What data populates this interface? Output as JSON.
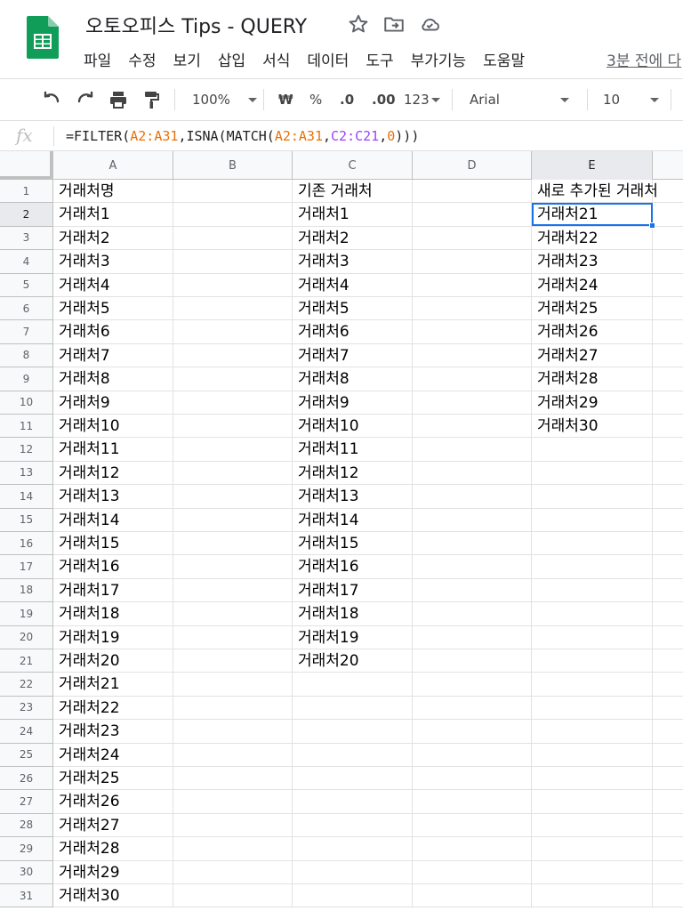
{
  "app": {
    "title": "오토오피스 Tips - QUERY",
    "last_edit": "3분 전에 다",
    "menu": [
      "파일",
      "수정",
      "보기",
      "삽입",
      "서식",
      "데이터",
      "도구",
      "부가기능",
      "도움말"
    ]
  },
  "toolbar": {
    "zoom": "100%",
    "currency": "₩",
    "percent": "%",
    "decrease_decimals": ".0",
    "increase_decimals": ".00",
    "more_formats": "123",
    "font": "Arial",
    "font_size": "10"
  },
  "formula_bar": {
    "fx": "fx",
    "tokens": [
      {
        "t": "=FILTER(",
        "c": ""
      },
      {
        "t": "A2:A31",
        "c": "o"
      },
      {
        "t": ",ISNA(MATCH(",
        "c": ""
      },
      {
        "t": "A2:A31",
        "c": "o"
      },
      {
        "t": ",",
        "c": ""
      },
      {
        "t": "C2:C21",
        "c": "p"
      },
      {
        "t": ",",
        "c": ""
      },
      {
        "t": "0",
        "c": "o"
      },
      {
        "t": ")))",
        "c": ""
      }
    ]
  },
  "grid": {
    "columns": [
      "A",
      "B",
      "C",
      "D",
      "E"
    ],
    "active_column": "E",
    "active_row": 2,
    "header_row": {
      "A": "거래처명",
      "C": "기존 거래처",
      "E": "새로 추가된 거래처"
    },
    "column_A": [
      "거래처1",
      "거래처2",
      "거래처3",
      "거래처4",
      "거래처5",
      "거래처6",
      "거래처7",
      "거래처8",
      "거래처9",
      "거래처10",
      "거래처11",
      "거래처12",
      "거래처13",
      "거래처14",
      "거래처15",
      "거래처16",
      "거래처17",
      "거래처18",
      "거래처19",
      "거래처20",
      "거래처21",
      "거래처22",
      "거래처23",
      "거래처24",
      "거래처25",
      "거래처26",
      "거래처27",
      "거래처28",
      "거래처29",
      "거래처30"
    ],
    "column_C": [
      "거래처1",
      "거래처2",
      "거래처3",
      "거래처4",
      "거래처5",
      "거래처6",
      "거래처7",
      "거래처8",
      "거래처9",
      "거래처10",
      "거래처11",
      "거래처12",
      "거래처13",
      "거래처14",
      "거래처15",
      "거래처16",
      "거래처17",
      "거래처18",
      "거래처19",
      "거래처20"
    ],
    "column_E": [
      "거래처21",
      "거래처22",
      "거래처23",
      "거래처24",
      "거래처25",
      "거래처26",
      "거래처27",
      "거래처28",
      "거래처29",
      "거래처30"
    ],
    "row_count": 31
  },
  "colors": {
    "accent": "#1a73e8",
    "sheets_green": "#0f9d58",
    "range_orange": "#e8710a",
    "range_purple": "#a142f4"
  }
}
